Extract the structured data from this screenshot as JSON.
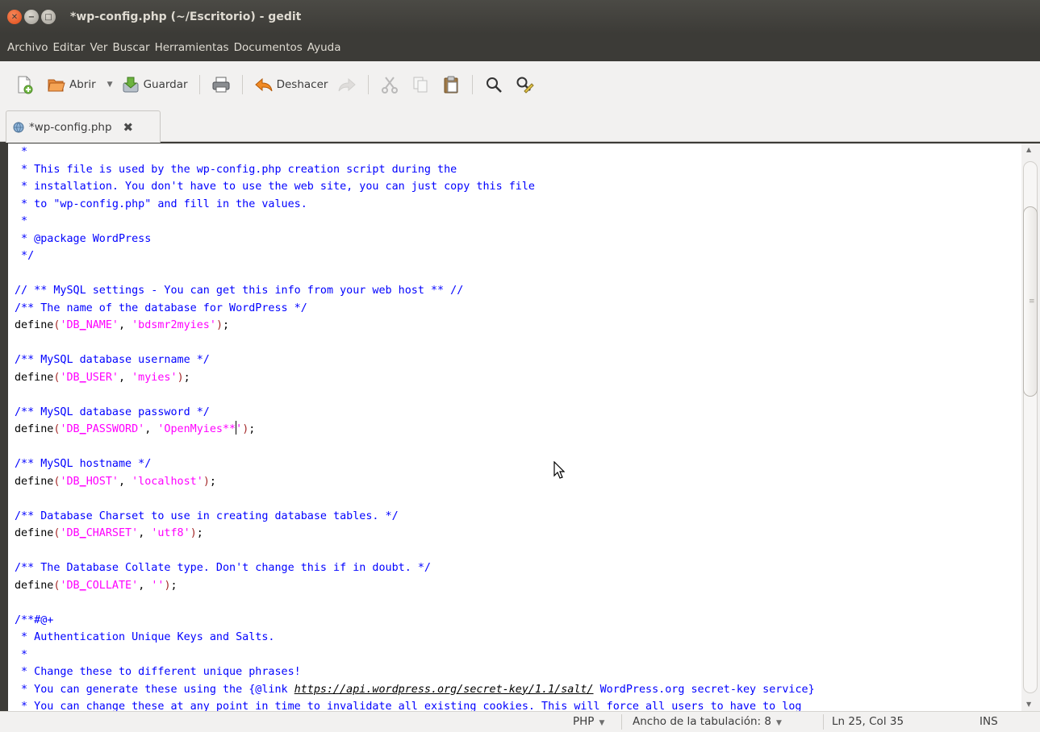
{
  "window": {
    "title": "*wp-config.php (~/Escritorio) - gedit"
  },
  "menu": [
    "Archivo",
    "Editar",
    "Ver",
    "Buscar",
    "Herramientas",
    "Documentos",
    "Ayuda"
  ],
  "toolbar": {
    "open_label": "Abrir",
    "save_label": "Guardar",
    "undo_label": "Deshacer"
  },
  "tab": {
    "label": "*wp-config.php"
  },
  "editor": {
    "lines": [
      [
        [
          "c",
          " *"
        ]
      ],
      [
        [
          "c",
          " * This file is used by the wp-config.php creation script during the"
        ]
      ],
      [
        [
          "c",
          " * installation. You don't have to use the web site, you can just copy this file"
        ]
      ],
      [
        [
          "c",
          " * to \"wp-config.php\" and fill in the values."
        ]
      ],
      [
        [
          "c",
          " *"
        ]
      ],
      [
        [
          "c",
          " * @package WordPress"
        ]
      ],
      [
        [
          "c",
          " */"
        ]
      ],
      [],
      [
        [
          "c",
          "// ** MySQL settings - You can get this info from your web host ** //"
        ]
      ],
      [
        [
          "c",
          "/** The name of the database for WordPress */"
        ]
      ],
      [
        [
          "t",
          "define"
        ],
        [
          "p",
          "("
        ],
        [
          "s",
          "'DB_NAME'"
        ],
        [
          "t",
          ", "
        ],
        [
          "s",
          "'bdsmr2myies'"
        ],
        [
          "p",
          ")"
        ],
        [
          "t",
          ";"
        ]
      ],
      [],
      [
        [
          "c",
          "/** MySQL database username */"
        ]
      ],
      [
        [
          "t",
          "define"
        ],
        [
          "p",
          "("
        ],
        [
          "s",
          "'DB_USER'"
        ],
        [
          "t",
          ", "
        ],
        [
          "s",
          "'myies'"
        ],
        [
          "p",
          ")"
        ],
        [
          "t",
          ";"
        ]
      ],
      [],
      [
        [
          "c",
          "/** MySQL database password */"
        ]
      ],
      [
        [
          "t",
          "define"
        ],
        [
          "p",
          "("
        ],
        [
          "s",
          "'DB_PASSWORD'"
        ],
        [
          "t",
          ", "
        ],
        [
          "s",
          "'OpenMyies**"
        ],
        [
          "cursor",
          ""
        ],
        [
          "s",
          "'"
        ],
        [
          "p",
          ")"
        ],
        [
          "t",
          ";"
        ]
      ],
      [],
      [
        [
          "c",
          "/** MySQL hostname */"
        ]
      ],
      [
        [
          "t",
          "define"
        ],
        [
          "p",
          "("
        ],
        [
          "s",
          "'DB_HOST'"
        ],
        [
          "t",
          ", "
        ],
        [
          "s",
          "'localhost'"
        ],
        [
          "p",
          ")"
        ],
        [
          "t",
          ";"
        ]
      ],
      [],
      [
        [
          "c",
          "/** Database Charset to use in creating database tables. */"
        ]
      ],
      [
        [
          "t",
          "define"
        ],
        [
          "p",
          "("
        ],
        [
          "s",
          "'DB_CHARSET'"
        ],
        [
          "t",
          ", "
        ],
        [
          "s",
          "'utf8'"
        ],
        [
          "p",
          ")"
        ],
        [
          "t",
          ";"
        ]
      ],
      [],
      [
        [
          "c",
          "/** The Database Collate type. Don't change this if in doubt. */"
        ]
      ],
      [
        [
          "t",
          "define"
        ],
        [
          "p",
          "("
        ],
        [
          "s",
          "'DB_COLLATE'"
        ],
        [
          "t",
          ", "
        ],
        [
          "s",
          "''"
        ],
        [
          "p",
          ")"
        ],
        [
          "t",
          ";"
        ]
      ],
      [],
      [
        [
          "c",
          "/**#@+"
        ]
      ],
      [
        [
          "c",
          " * Authentication Unique Keys and Salts."
        ]
      ],
      [
        [
          "c",
          " *"
        ]
      ],
      [
        [
          "c",
          " * Change these to different unique phrases!"
        ]
      ],
      [
        [
          "c",
          " * You can generate these using the {@link "
        ],
        [
          "lk",
          "https://api.wordpress.org/secret-key/1.1/salt/"
        ],
        [
          "c",
          " WordPress.org secret-key service}"
        ]
      ],
      [
        [
          "c",
          " * You can change these at any point in time to invalidate all existing cookies. This will force all users to have to log"
        ]
      ]
    ]
  },
  "statusbar": {
    "language": "PHP",
    "tab_width": "Ancho de la tabulación:  8",
    "position": "Ln 25, Col 35",
    "mode": "INS"
  }
}
